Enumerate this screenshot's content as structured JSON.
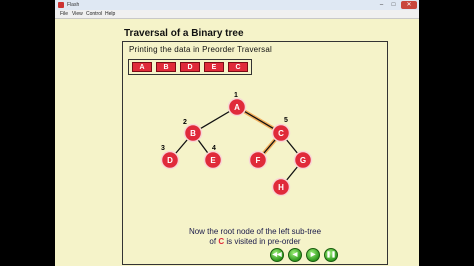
{
  "window": {
    "title": "Flash",
    "minimize": "–",
    "maximize": "□",
    "close": "✕"
  },
  "menu": [
    "File",
    "View",
    "Control",
    "Help"
  ],
  "page": {
    "title": "Traversal of a Binary tree",
    "subtitle": "Printing the data in Preorder Traversal",
    "output": [
      "A",
      "B",
      "D",
      "E",
      "C"
    ],
    "caption_line1": "Now the root node of the left sub-tree",
    "caption_line2_pre": "of ",
    "caption_line2_hl": "C",
    "caption_line2_post": " is visited in pre-order"
  },
  "tree": {
    "nodes": [
      {
        "id": "A",
        "number": "1"
      },
      {
        "id": "B",
        "number": "2"
      },
      {
        "id": "C",
        "number": "5"
      },
      {
        "id": "D",
        "number": "3"
      },
      {
        "id": "E",
        "number": "4"
      },
      {
        "id": "F",
        "number": ""
      },
      {
        "id": "G",
        "number": ""
      },
      {
        "id": "H",
        "number": ""
      }
    ],
    "edges": [
      [
        "A",
        "B"
      ],
      [
        "A",
        "C"
      ],
      [
        "B",
        "D"
      ],
      [
        "B",
        "E"
      ],
      [
        "C",
        "F"
      ],
      [
        "C",
        "G"
      ],
      [
        "G",
        "H"
      ]
    ],
    "highlighted_edges": [
      [
        "A",
        "C"
      ],
      [
        "C",
        "F"
      ]
    ],
    "node_color": "#e02a3a",
    "highlight_color": "#f2a24a"
  },
  "controls": [
    {
      "name": "rewind-button",
      "glyph": "◀◀"
    },
    {
      "name": "back-button",
      "glyph": "◀"
    },
    {
      "name": "play-button",
      "glyph": "▶"
    },
    {
      "name": "pause-button",
      "glyph": "❚❚"
    }
  ]
}
